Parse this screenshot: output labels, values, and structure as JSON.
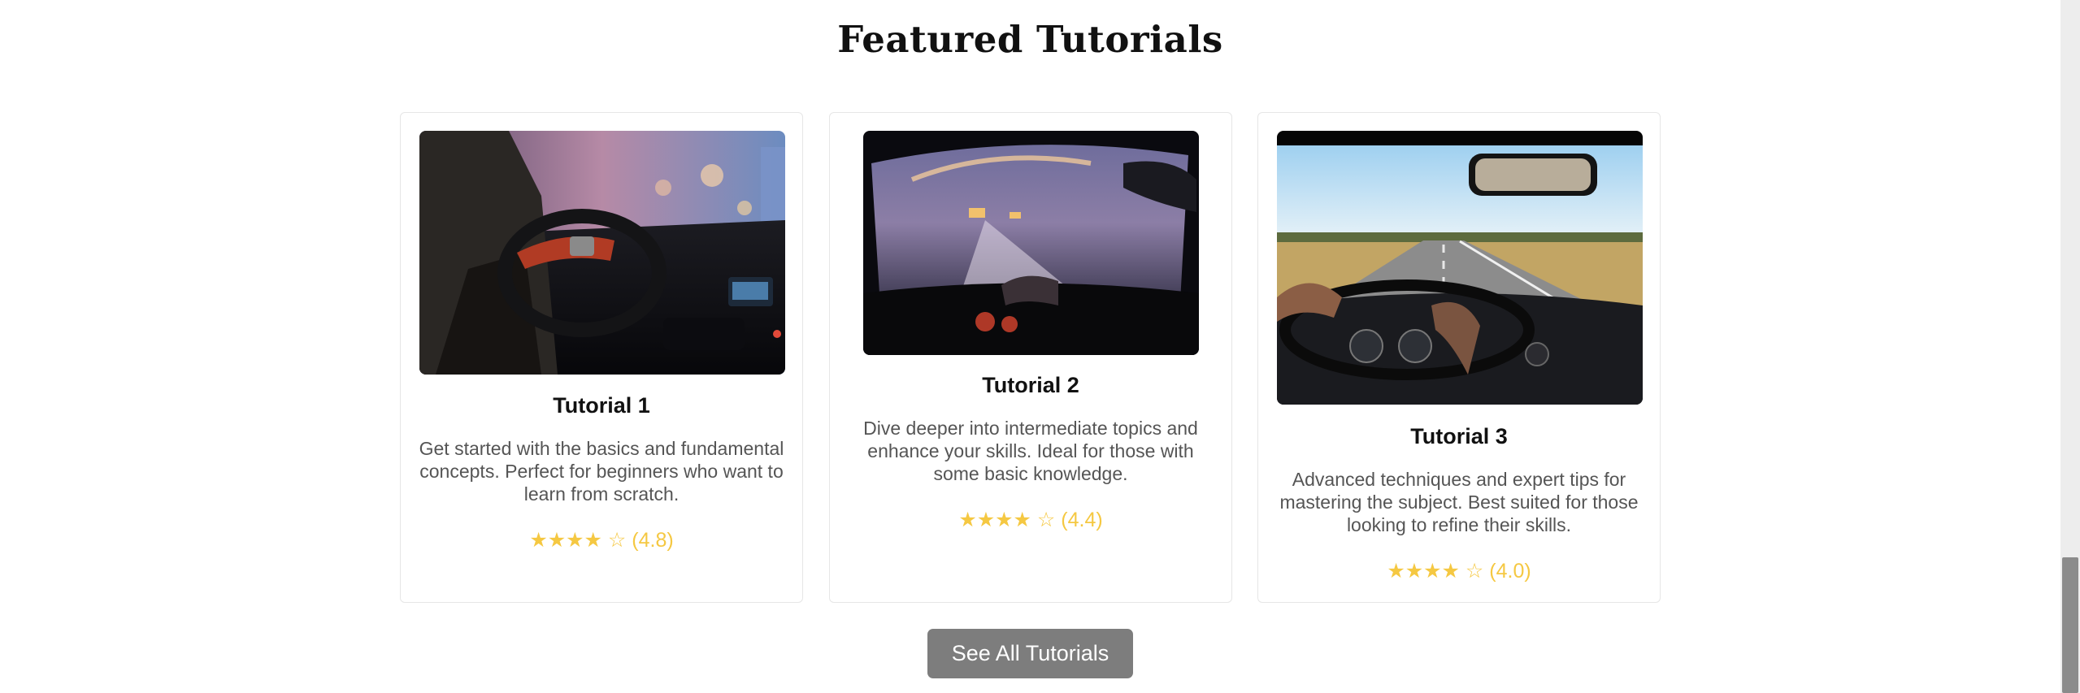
{
  "section": {
    "title": "Featured Tutorials"
  },
  "cards": [
    {
      "title": "Tutorial 1",
      "description": "Get started with the basics and fundamental concepts. Perfect for beginners who want to learn from scratch.",
      "rating_text": "★★★★ ☆ (4.8)",
      "rating": 4.8
    },
    {
      "title": "Tutorial 2",
      "description": "Dive deeper into intermediate topics and enhance your skills. Ideal for those with some basic knowledge.",
      "rating_text": "★★★★ ☆ (4.4)",
      "rating": 4.4
    },
    {
      "title": "Tutorial 3",
      "description": "Advanced techniques and expert tips for mastering the subject. Best suited for those looking to refine their skills.",
      "rating_text": "★★★★ ☆ (4.0)",
      "rating": 4.0
    }
  ],
  "cta": {
    "label": "See All Tutorials"
  },
  "colors": {
    "star": "#f5c842",
    "button": "#7d7d7d",
    "card_border": "#e6e6e6"
  }
}
